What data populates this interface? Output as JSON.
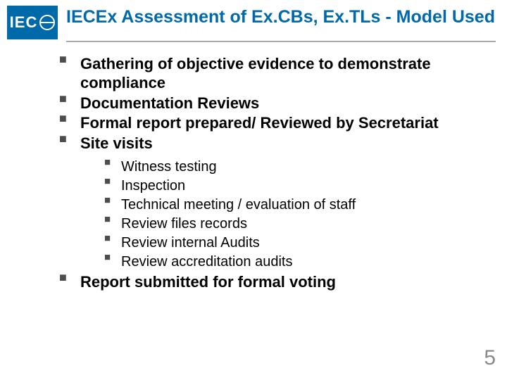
{
  "logo": {
    "text": "IEC"
  },
  "title": "IECEx Assessment of Ex.CBs, Ex.TLs - Model Used",
  "bullets": [
    {
      "text": "Gathering of objective evidence to demonstrate compliance"
    },
    {
      "text": "Documentation Reviews"
    },
    {
      "text": "Formal report prepared/ Reviewed by Secretariat"
    },
    {
      "text": "Site visits",
      "sub": [
        "Witness testing",
        "Inspection",
        "Technical meeting / evaluation of staff",
        "Review files records",
        "Review internal Audits",
        "Review accreditation audits"
      ]
    },
    {
      "text": "Report submitted for formal voting"
    }
  ],
  "page_number": "5"
}
